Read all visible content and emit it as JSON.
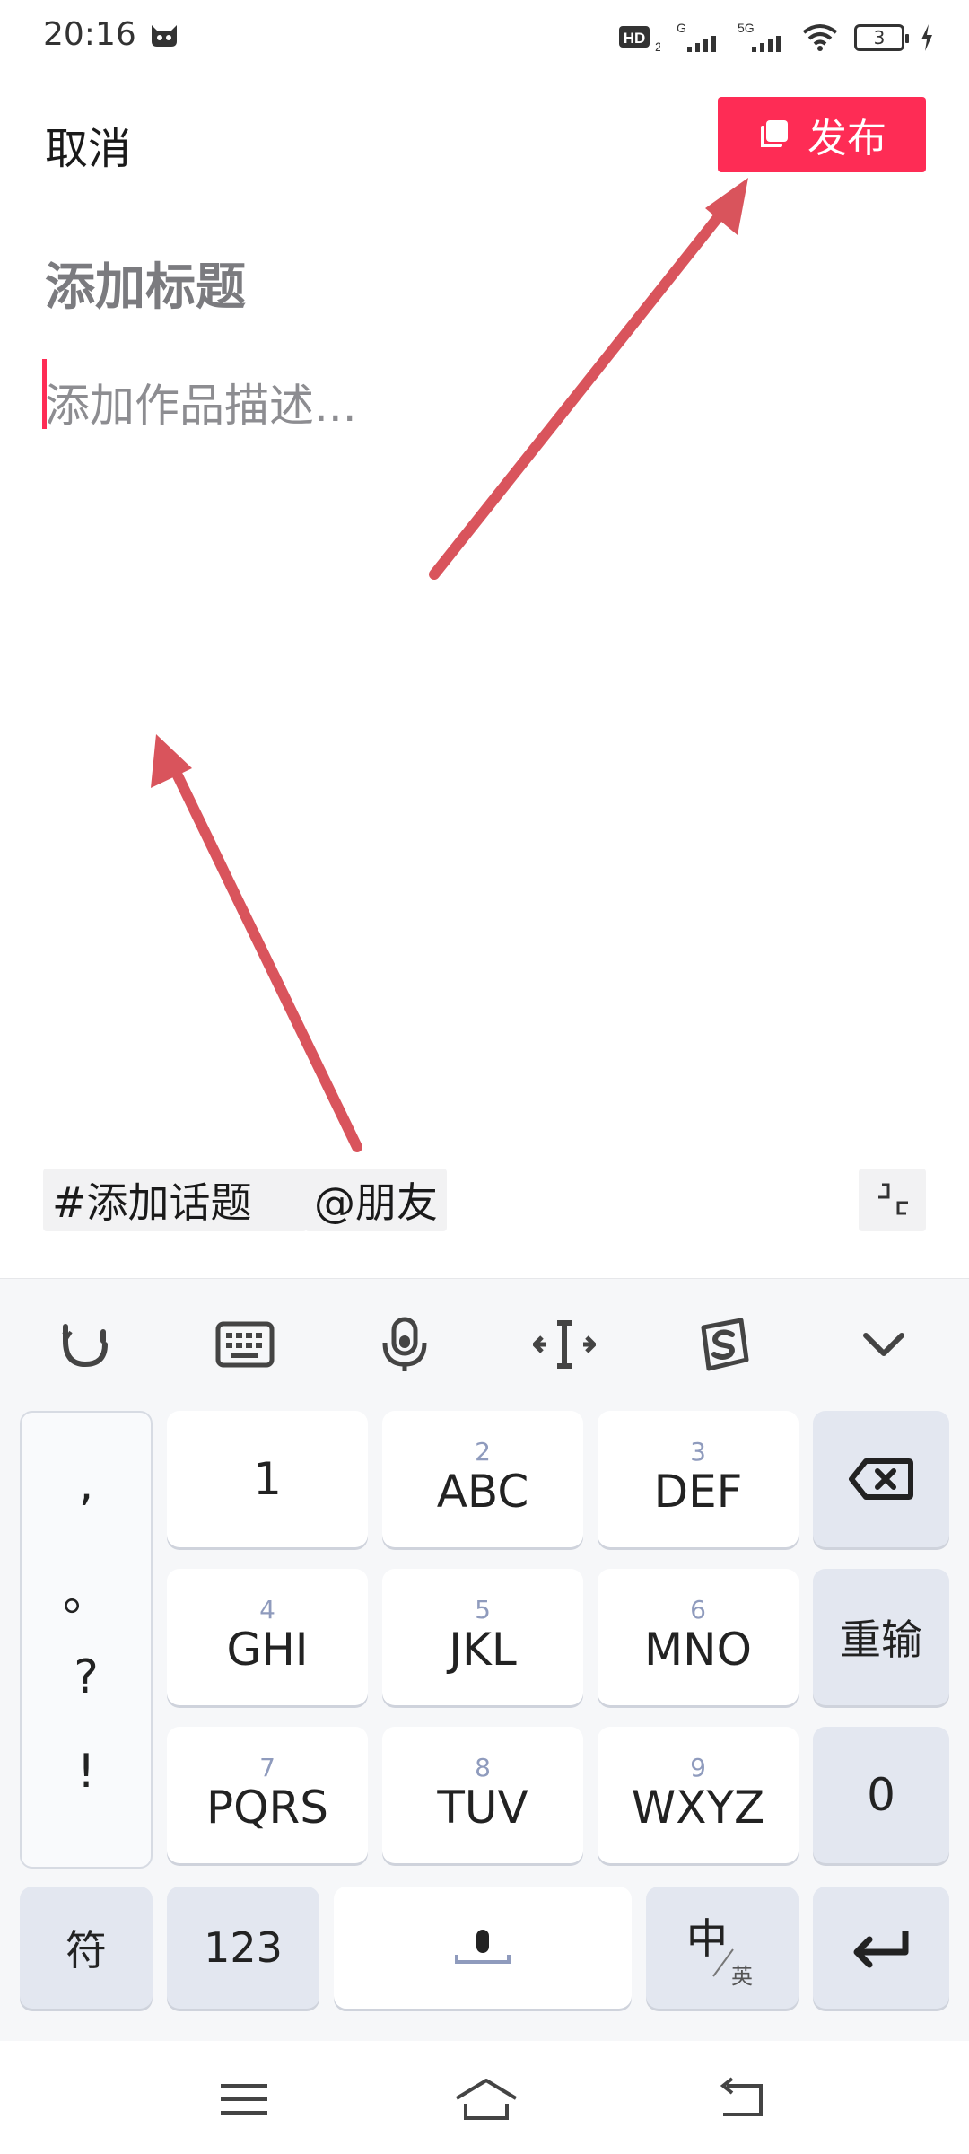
{
  "status_bar": {
    "time": "20:16",
    "hd_label": "HD",
    "sim1_label": "G",
    "sim2_label": "5G",
    "battery": "3"
  },
  "header": {
    "cancel_label": "取消",
    "publish_label": "发布",
    "publish_color": "#fe2c55"
  },
  "editor": {
    "title_placeholder": "添加标题",
    "description_placeholder": "添加作品描述..."
  },
  "chips": {
    "topic_label": "#添加话题",
    "mention_label": "@朋友"
  },
  "keyboard": {
    "toolbar_icons": [
      "emoji-icon",
      "keyboard-icon",
      "microphone-icon",
      "cursor-move-icon",
      "sogou-icon",
      "chevron-down-icon"
    ],
    "punctuation": [
      ",",
      "。",
      "?",
      "!"
    ],
    "keys": {
      "k1": {
        "main": "1"
      },
      "k2": {
        "num": "2",
        "main": "ABC"
      },
      "k3": {
        "num": "3",
        "main": "DEF"
      },
      "k4": {
        "num": "4",
        "main": "GHI"
      },
      "k5": {
        "num": "5",
        "main": "JKL"
      },
      "k6": {
        "num": "6",
        "main": "MNO"
      },
      "k7": {
        "num": "7",
        "main": "PQRS"
      },
      "k8": {
        "num": "8",
        "main": "TUV"
      },
      "k9": {
        "num": "9",
        "main": "WXYZ"
      },
      "reset": "重输",
      "zero": "0",
      "symbols": "符",
      "numbers": "123",
      "lang_main": "中",
      "lang_sub": "英"
    }
  },
  "annotation_color": "#d9545c"
}
